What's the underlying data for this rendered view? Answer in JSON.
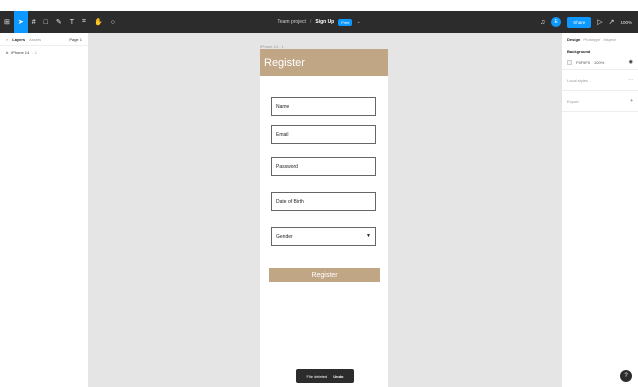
{
  "toolbar": {
    "tools": [
      {
        "name": "main-menu-icon",
        "glyph": "⊞"
      },
      {
        "name": "move-tool-icon",
        "glyph": "➤"
      },
      {
        "name": "frame-tool-icon",
        "glyph": "#"
      },
      {
        "name": "shape-tool-icon",
        "glyph": "□"
      },
      {
        "name": "pen-tool-icon",
        "glyph": "✎"
      },
      {
        "name": "text-tool-icon",
        "glyph": "T"
      },
      {
        "name": "resources-icon",
        "glyph": "⌗"
      },
      {
        "name": "hand-tool-icon",
        "glyph": "✋"
      },
      {
        "name": "comment-icon",
        "glyph": "○"
      }
    ],
    "project": "Team project",
    "separator": "/",
    "file_name": "Sign Up",
    "file_badge": "Free",
    "avatar_initial": "E",
    "share_label": "Share",
    "zoom": "100%"
  },
  "left_panel": {
    "tab_layers": "Layers",
    "tab_assets": "Assets",
    "page_label": "Page 1",
    "layer_name": "iPhone 14",
    "layer_sub": "- 1"
  },
  "canvas": {
    "frame_label": "iPhone 14 - 1",
    "header": "Register",
    "fields": {
      "name": "Name",
      "email": "Email",
      "password": "Password",
      "dob": "Date of Birth",
      "gender": "Gender"
    },
    "submit_label": "Register",
    "toast": {
      "message": "File deleted",
      "action": "Undo"
    }
  },
  "right_panel": {
    "tab_design": "Design",
    "tab_prototype": "Prototype",
    "tab_inspect": "Inspect",
    "background_title": "Background",
    "bg_color": "F5F5F5",
    "bg_opacity": "100%",
    "local_styles": "Local styles",
    "export": "Export"
  },
  "colors": {
    "accent": "#0d99ff",
    "brand": "#c1a686",
    "toolbar": "#2c2c2c",
    "canvas": "#e5e5e5"
  }
}
